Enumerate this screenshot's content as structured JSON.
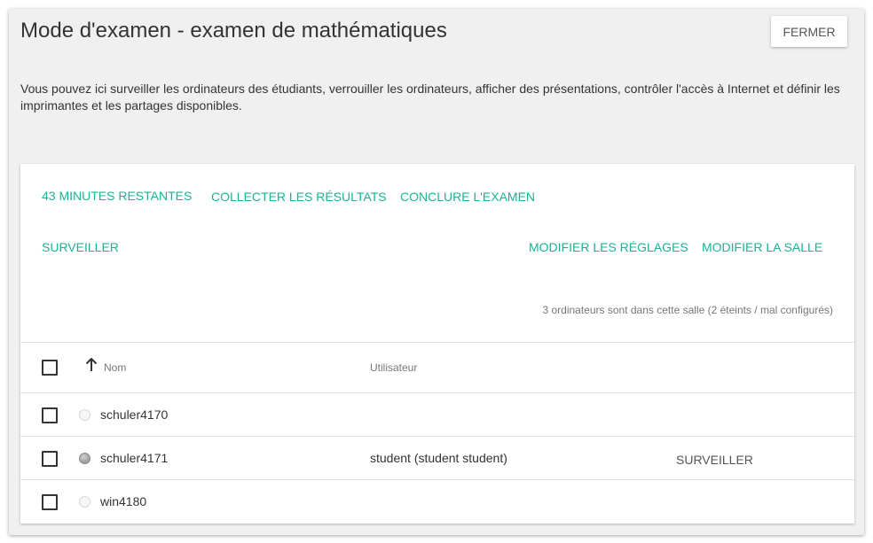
{
  "dialog": {
    "title": "Mode d'examen - examen de mathématiques",
    "close_label": "FERMER",
    "description": "Vous pouvez ici surveiller les ordinateurs des étudiants, verrouiller les ordinateurs, afficher des présentations, contrôler l'accès à Internet et définir les imprimantes et les partages disponibles."
  },
  "actions": {
    "time_remaining": "43 MINUTES RESTANTES",
    "collect_results": "COLLECTER LES RÉSULTATS",
    "finish_exam": "CONCLURE L'EXAMEN",
    "monitor": "SURVEILLER",
    "edit_settings": "MODIFIER LES RÉGLAGES",
    "edit_room": "MODIFIER LA SALLE"
  },
  "room_status": "3 ordinateurs sont dans cette salle (2 éteints / mal configurés)",
  "table": {
    "columns": {
      "name": "Nom",
      "user": "Utilisateur"
    },
    "rows": [
      {
        "name": "schuler4170",
        "user": "",
        "action": "",
        "status": "off"
      },
      {
        "name": "schuler4171",
        "user": "student (student student)",
        "action": "SURVEILLER",
        "status": "on"
      },
      {
        "name": "win4180",
        "user": "",
        "action": "",
        "status": "off"
      }
    ]
  },
  "colors": {
    "accent": "#1ab394",
    "panel_bg": "#f0f0f0"
  },
  "icons": {
    "sort": "arrow-up-icon",
    "status": "status-dot-icon"
  }
}
